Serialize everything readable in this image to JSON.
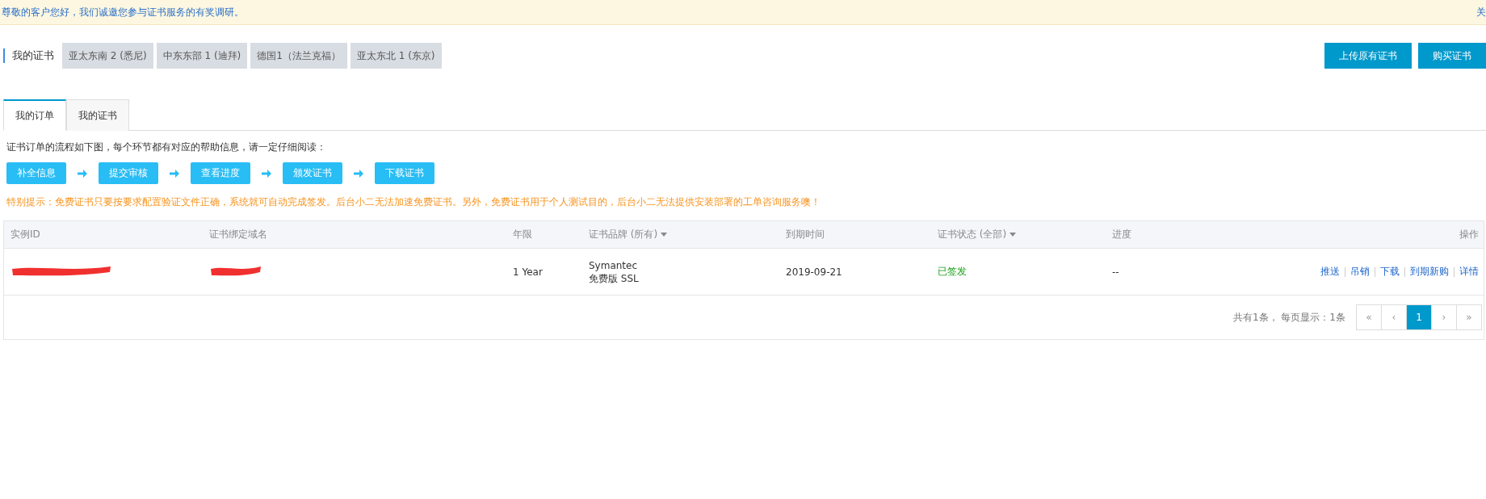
{
  "banner": {
    "text": "尊敬的客户您好，我们诚邀您参与证书服务的有奖调研。",
    "close": "关"
  },
  "region_bar": {
    "title": "我的证书",
    "regions": [
      {
        "label": "亚太东南 2 (悉尼)"
      },
      {
        "label": "中东东部 1 (迪拜)"
      },
      {
        "label": "德国1（法兰克福）"
      },
      {
        "label": "亚太东北 1 (东京)"
      }
    ]
  },
  "header_buttons": [
    "上传原有证书",
    "购买证书"
  ],
  "tabs": [
    {
      "label": "我的订单",
      "selected": true
    },
    {
      "label": "我的证书",
      "selected": false
    }
  ],
  "flow": {
    "intro": "证书订单的流程如下图，每个环节都有对应的帮助信息，请一定仔细阅读：",
    "steps": [
      "补全信息",
      "提交审核",
      "查看进度",
      "颁发证书",
      "下载证书"
    ]
  },
  "notice": "特别提示：免费证书只要按要求配置验证文件正确，系统就可自动完成签发。后台小二无法加速免费证书。另外，免费证书用于个人测试目的，后台小二无法提供安装部署的工单咨询服务噢！",
  "table": {
    "columns": [
      {
        "label": "实例ID",
        "dropdown": false
      },
      {
        "label": "证书绑定域名",
        "dropdown": false
      },
      {
        "label": "年限",
        "dropdown": false
      },
      {
        "label": "证书品牌 (所有)",
        "dropdown": true
      },
      {
        "label": "到期时间",
        "dropdown": false
      },
      {
        "label": "证书状态 (全部)",
        "dropdown": true
      },
      {
        "label": "进度",
        "dropdown": false
      },
      {
        "label": "操作",
        "dropdown": false
      }
    ],
    "rows": [
      {
        "cells": [
          {
            "kind": "redacted"
          },
          {
            "kind": "redacted"
          },
          {
            "kind": "text",
            "text": "1 Year"
          },
          {
            "kind": "lines",
            "lines": [
              "Symantec",
              "免费版 SSL"
            ]
          },
          {
            "kind": "text",
            "text": "2019-09-21"
          },
          {
            "kind": "status",
            "text": "已签发"
          },
          {
            "kind": "text",
            "text": "--"
          },
          {
            "kind": "links",
            "links": [
              "推送",
              "吊销",
              "下载",
              "到期新购",
              "详情"
            ]
          }
        ]
      }
    ]
  },
  "pagination": {
    "summary": "共有1条， 每页显示：1条",
    "pages": [
      {
        "label": "«",
        "selected": false
      },
      {
        "label": "‹",
        "selected": false
      },
      {
        "label": "1",
        "selected": true
      },
      {
        "label": "›",
        "selected": false
      },
      {
        "label": "»",
        "selected": false
      }
    ]
  }
}
